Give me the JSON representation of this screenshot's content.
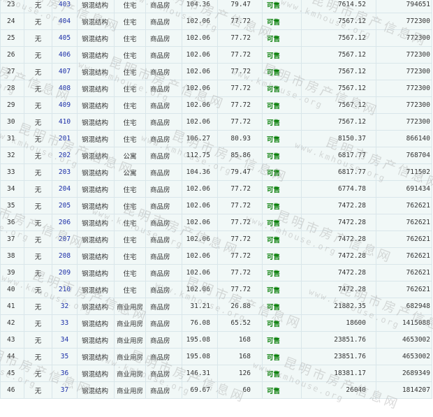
{
  "watermark": {
    "cn": "昆明市房产信息网",
    "en": "www.kmhouse.org"
  },
  "units": [
    {
      "no": "23",
      "wu": "无",
      "room": "403",
      "structure": "钢混结构",
      "use": "住宅",
      "type": "商品房",
      "build_area": "104.36",
      "inner_area": "79.47",
      "status": "可售",
      "unit_price": "7614.52",
      "total": "794651"
    },
    {
      "no": "24",
      "wu": "无",
      "room": "404",
      "structure": "钢混结构",
      "use": "住宅",
      "type": "商品房",
      "build_area": "102.06",
      "inner_area": "77.72",
      "status": "可售",
      "unit_price": "7567.12",
      "total": "772300"
    },
    {
      "no": "25",
      "wu": "无",
      "room": "405",
      "structure": "钢混结构",
      "use": "住宅",
      "type": "商品房",
      "build_area": "102.06",
      "inner_area": "77.72",
      "status": "可售",
      "unit_price": "7567.12",
      "total": "772300"
    },
    {
      "no": "26",
      "wu": "无",
      "room": "406",
      "structure": "钢混结构",
      "use": "住宅",
      "type": "商品房",
      "build_area": "102.06",
      "inner_area": "77.72",
      "status": "可售",
      "unit_price": "7567.12",
      "total": "772300"
    },
    {
      "no": "27",
      "wu": "无",
      "room": "407",
      "structure": "钢混结构",
      "use": "住宅",
      "type": "商品房",
      "build_area": "102.06",
      "inner_area": "77.72",
      "status": "可售",
      "unit_price": "7567.12",
      "total": "772300"
    },
    {
      "no": "28",
      "wu": "无",
      "room": "408",
      "structure": "钢混结构",
      "use": "住宅",
      "type": "商品房",
      "build_area": "102.06",
      "inner_area": "77.72",
      "status": "可售",
      "unit_price": "7567.12",
      "total": "772300"
    },
    {
      "no": "29",
      "wu": "无",
      "room": "409",
      "structure": "钢混结构",
      "use": "住宅",
      "type": "商品房",
      "build_area": "102.06",
      "inner_area": "77.72",
      "status": "可售",
      "unit_price": "7567.12",
      "total": "772300"
    },
    {
      "no": "30",
      "wu": "无",
      "room": "410",
      "structure": "钢混结构",
      "use": "住宅",
      "type": "商品房",
      "build_area": "102.06",
      "inner_area": "77.72",
      "status": "可售",
      "unit_price": "7567.12",
      "total": "772300"
    },
    {
      "no": "31",
      "wu": "无",
      "room": "201",
      "structure": "钢混结构",
      "use": "住宅",
      "type": "商品房",
      "build_area": "106.27",
      "inner_area": "80.93",
      "status": "可售",
      "unit_price": "8150.37",
      "total": "866140"
    },
    {
      "no": "32",
      "wu": "无",
      "room": "202",
      "structure": "钢混结构",
      "use": "公寓",
      "type": "商品房",
      "build_area": "112.75",
      "inner_area": "85.86",
      "status": "可售",
      "unit_price": "6817.77",
      "total": "768704"
    },
    {
      "no": "33",
      "wu": "无",
      "room": "203",
      "structure": "钢混结构",
      "use": "公寓",
      "type": "商品房",
      "build_area": "104.36",
      "inner_area": "79.47",
      "status": "可售",
      "unit_price": "6817.77",
      "total": "711502"
    },
    {
      "no": "34",
      "wu": "无",
      "room": "204",
      "structure": "钢混结构",
      "use": "住宅",
      "type": "商品房",
      "build_area": "102.06",
      "inner_area": "77.72",
      "status": "可售",
      "unit_price": "6774.78",
      "total": "691434"
    },
    {
      "no": "35",
      "wu": "无",
      "room": "205",
      "structure": "钢混结构",
      "use": "住宅",
      "type": "商品房",
      "build_area": "102.06",
      "inner_area": "77.72",
      "status": "可售",
      "unit_price": "7472.28",
      "total": "762621"
    },
    {
      "no": "36",
      "wu": "无",
      "room": "206",
      "structure": "钢混结构",
      "use": "住宅",
      "type": "商品房",
      "build_area": "102.06",
      "inner_area": "77.72",
      "status": "可售",
      "unit_price": "7472.28",
      "total": "762621"
    },
    {
      "no": "37",
      "wu": "无",
      "room": "207",
      "structure": "钢混结构",
      "use": "住宅",
      "type": "商品房",
      "build_area": "102.06",
      "inner_area": "77.72",
      "status": "可售",
      "unit_price": "7472.28",
      "total": "762621"
    },
    {
      "no": "38",
      "wu": "无",
      "room": "208",
      "structure": "钢混结构",
      "use": "住宅",
      "type": "商品房",
      "build_area": "102.06",
      "inner_area": "77.72",
      "status": "可售",
      "unit_price": "7472.28",
      "total": "762621"
    },
    {
      "no": "39",
      "wu": "无",
      "room": "209",
      "structure": "钢混结构",
      "use": "住宅",
      "type": "商品房",
      "build_area": "102.06",
      "inner_area": "77.72",
      "status": "可售",
      "unit_price": "7472.28",
      "total": "762621"
    },
    {
      "no": "40",
      "wu": "无",
      "room": "210",
      "structure": "钢混结构",
      "use": "住宅",
      "type": "商品房",
      "build_area": "102.06",
      "inner_area": "77.72",
      "status": "可售",
      "unit_price": "7472.28",
      "total": "762621"
    },
    {
      "no": "41",
      "wu": "无",
      "room": "32",
      "structure": "钢混结构",
      "use": "商业用房",
      "type": "商品房",
      "build_area": "31.21",
      "inner_area": "26.88",
      "status": "可售",
      "unit_price": "21882.35",
      "total": "682948"
    },
    {
      "no": "42",
      "wu": "无",
      "room": "33",
      "structure": "钢混结构",
      "use": "商业用房",
      "type": "商品房",
      "build_area": "76.08",
      "inner_area": "65.52",
      "status": "可售",
      "unit_price": "18600",
      "total": "1415088"
    },
    {
      "no": "43",
      "wu": "无",
      "room": "34",
      "structure": "钢混结构",
      "use": "商业用房",
      "type": "商品房",
      "build_area": "195.08",
      "inner_area": "168",
      "status": "可售",
      "unit_price": "23851.76",
      "total": "4653002"
    },
    {
      "no": "44",
      "wu": "无",
      "room": "35",
      "structure": "钢混结构",
      "use": "商业用房",
      "type": "商品房",
      "build_area": "195.08",
      "inner_area": "168",
      "status": "可售",
      "unit_price": "23851.76",
      "total": "4653002"
    },
    {
      "no": "45",
      "wu": "无",
      "room": "36",
      "structure": "钢混结构",
      "use": "商业用房",
      "type": "商品房",
      "build_area": "146.31",
      "inner_area": "126",
      "status": "可售",
      "unit_price": "18381.17",
      "total": "2689349"
    },
    {
      "no": "46",
      "wu": "无",
      "room": "37",
      "structure": "钢混结构",
      "use": "商业用房",
      "type": "商品房",
      "build_area": "69.67",
      "inner_area": "60",
      "status": "可售",
      "unit_price": "26040",
      "total": "1814207"
    }
  ]
}
